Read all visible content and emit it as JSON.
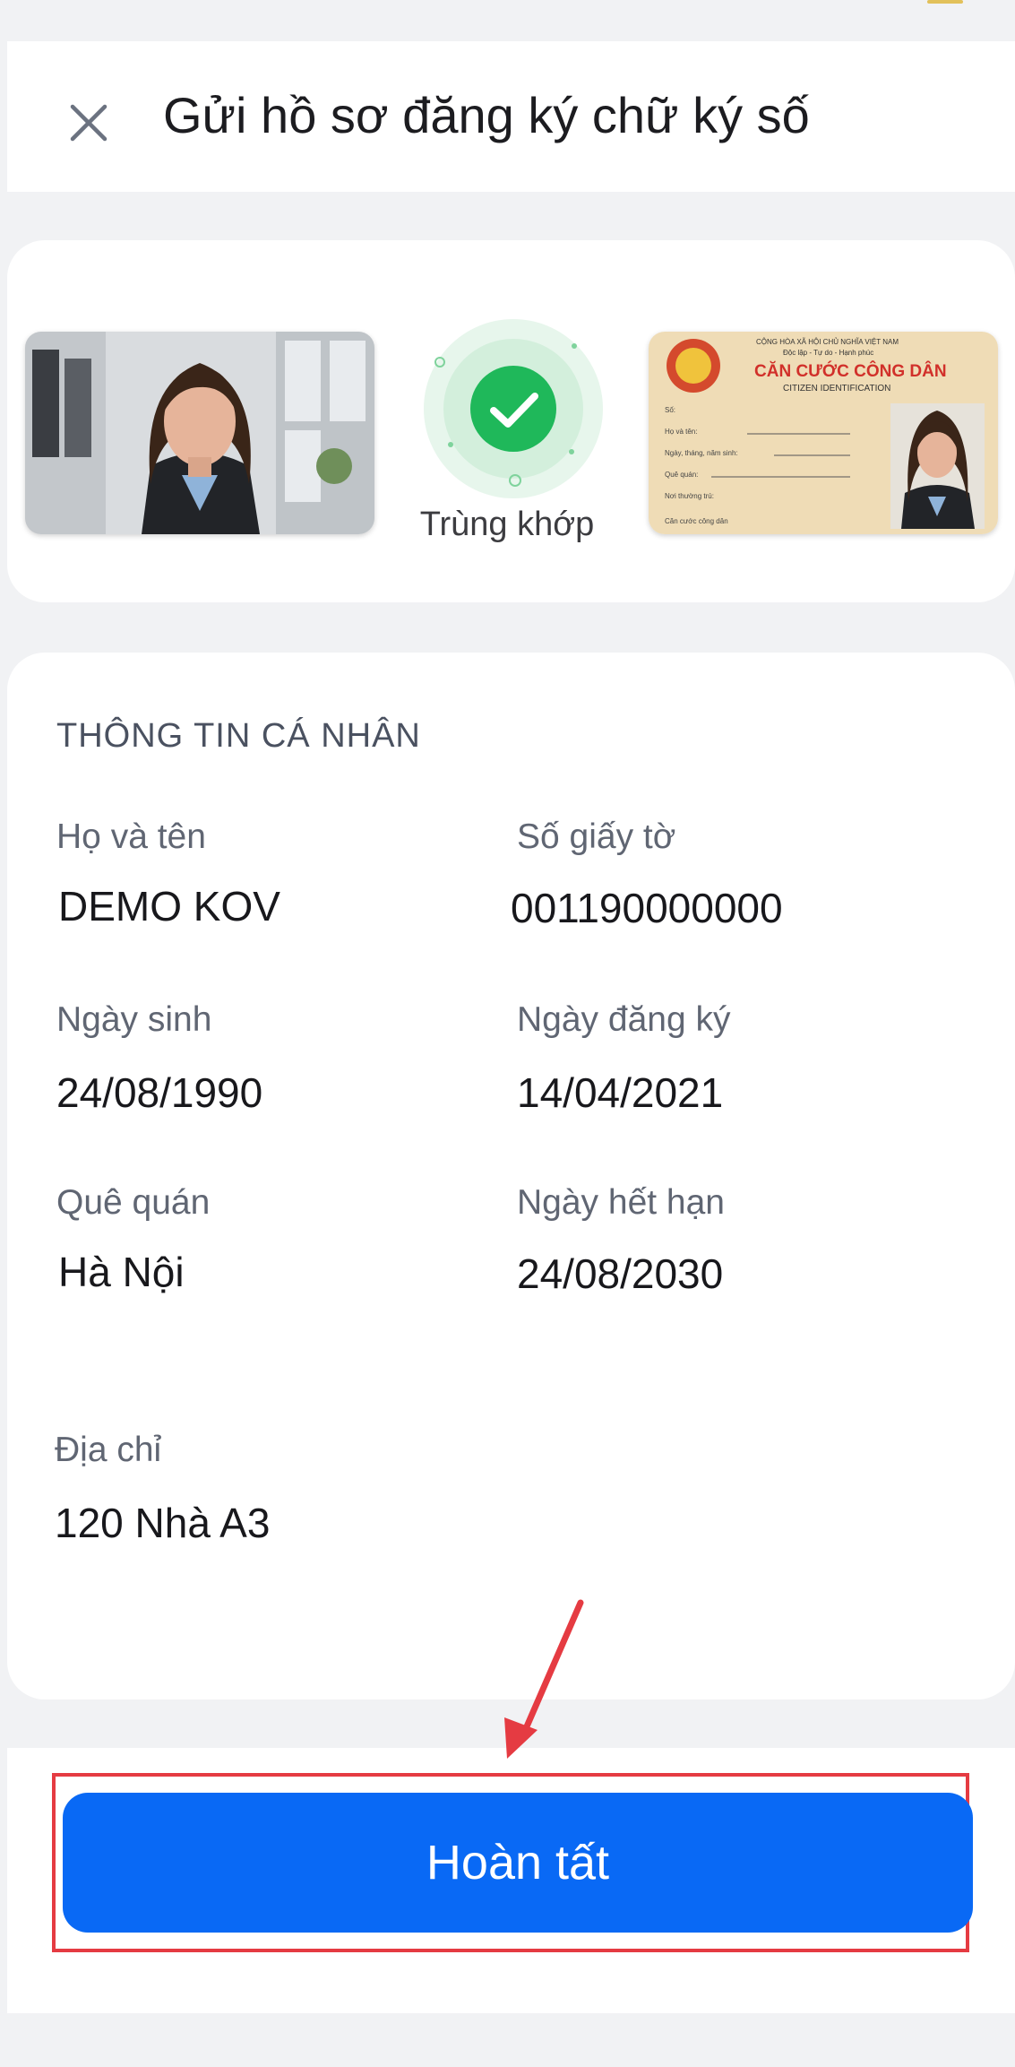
{
  "header": {
    "title": "Gửi hồ sơ đăng ký chữ ký số",
    "close_icon": "close-icon"
  },
  "verification": {
    "match_label": "Trùng khớp",
    "status_color": "#22b35a",
    "id_card": {
      "heading": "CỘNG HÒA XÃ HỘI CHỦ NGHĨA VIỆT NAM",
      "motto": "Độc lập - Tự do - Hạnh phúc",
      "title": "CĂN CƯỚC CÔNG DÂN",
      "subtitle": "CITIZEN IDENTIFICATION",
      "fields": [
        "Số:",
        "Họ và tên:",
        "Ngày, tháng, năm sinh:",
        "Quê quán:",
        "Nơi thường trú:"
      ],
      "footer": "Căn cước công dân"
    }
  },
  "personal_info": {
    "section_title": "THÔNG TIN CÁ NHÂN",
    "full_name_label": "Họ và tên",
    "full_name": "DEMO KOV",
    "doc_number_label": "Số giấy tờ",
    "doc_number": "001190000000",
    "dob_label": "Ngày sinh",
    "dob": "24/08/1990",
    "reg_date_label": "Ngày đăng ký",
    "reg_date": "14/04/2021",
    "hometown_label": "Quê quán",
    "hometown": "Hà Nội",
    "expiry_label": "Ngày hết hạn",
    "expiry": "24/08/2030",
    "address_label": "Địa chỉ",
    "address": "120 Nhà A3"
  },
  "footer": {
    "complete_button": "Hoàn tất",
    "button_color": "#0969f5",
    "annotation_color": "#e53b42"
  }
}
